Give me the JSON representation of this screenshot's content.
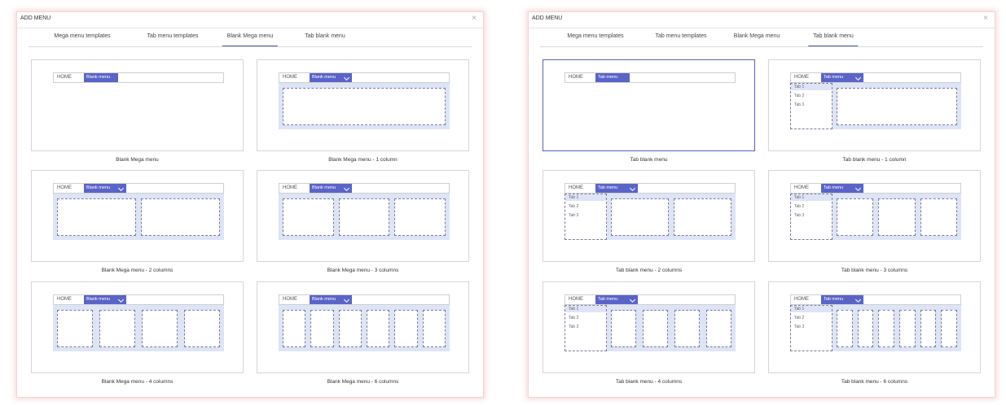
{
  "left_dialog": {
    "title": "ADD MENU",
    "close": "×",
    "tabs": [
      "Mega menu templates",
      "Tab menu templates",
      "Blank Mega menu",
      "Tab blank menu"
    ],
    "active_tab": "Blank Mega menu",
    "nav_home": "HOME",
    "nav_menu": "Blank menu",
    "cards": [
      {
        "caption": "Blank Mega menu",
        "columns": 0
      },
      {
        "caption": "Blank Mega menu - 1 column",
        "columns": 1
      },
      {
        "caption": "Blank Mega menu - 2 columns",
        "columns": 2
      },
      {
        "caption": "Blank Mega menu - 3 columns",
        "columns": 3
      },
      {
        "caption": "Blank Mega menu - 4 columns",
        "columns": 4
      },
      {
        "caption": "Blank Mega menu - 6 columns",
        "columns": 6
      }
    ]
  },
  "right_dialog": {
    "title": "ADD MENU",
    "close": "×",
    "tabs": [
      "Mega menu templates",
      "Tab menu templates",
      "Blank Mega menu",
      "Tab blank menu"
    ],
    "active_tab": "Tab blank menu",
    "nav_home": "HOME",
    "nav_menu": "Tab menu",
    "tab_labels": [
      "Tab 1",
      "Tab 2",
      "Tab 3"
    ],
    "cards": [
      {
        "caption": "Tab blank menu",
        "columns": 0
      },
      {
        "caption": "Tab blank menu - 1 column",
        "columns": 1
      },
      {
        "caption": "Tab blank menu - 2 columns",
        "columns": 2
      },
      {
        "caption": "Tab blank menu - 3 columns",
        "columns": 3
      },
      {
        "caption": "Tab blank menu - 4 columns",
        "columns": 4
      },
      {
        "caption": "Tab blank menu - 6 columns",
        "columns": 6
      }
    ],
    "selected_card": 0
  },
  "colors": {
    "accent": "#5a64c8",
    "panel": "#dde4f6",
    "dialog_glow": "#f2d4d4"
  },
  "icons": {
    "close": "close-icon",
    "chevron": "chevron-down-icon"
  }
}
